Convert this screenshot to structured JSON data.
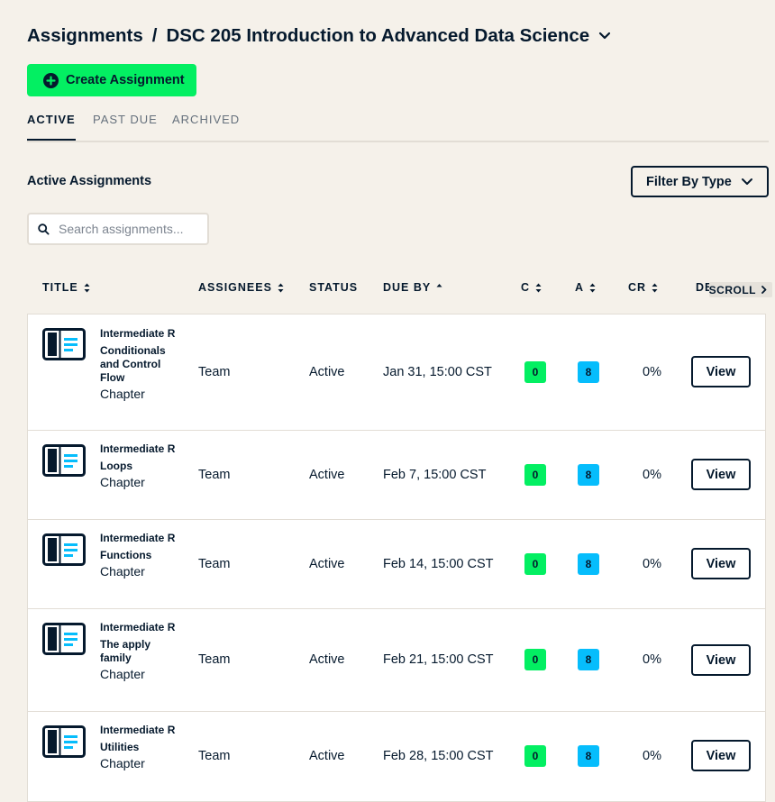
{
  "header": {
    "section": "Assignments",
    "separator": "/",
    "course": "DSC 205 Introduction to Advanced Data Science",
    "create_label": "Create Assignment"
  },
  "tabs": [
    {
      "label": "ACTIVE",
      "active": true
    },
    {
      "label": "PAST DUE",
      "active": false
    },
    {
      "label": "ARCHIVED",
      "active": false
    }
  ],
  "section": {
    "title": "Active Assignments",
    "filter_label": "Filter By Type"
  },
  "search": {
    "placeholder": "Search assignments..."
  },
  "table": {
    "columns": {
      "title": "TITLE",
      "assignees": "ASSIGNEES",
      "status": "STATUS",
      "due_by": "DUE BY",
      "c": "C",
      "a": "A",
      "cr": "CR",
      "desc": "DE"
    },
    "scroll_label": "SCROLL",
    "view_label": "View",
    "rows": [
      {
        "course": "Intermediate R",
        "chapter": "Conditionals and Control Flow",
        "type": "Chapter",
        "assignees": "Team",
        "status": "Active",
        "due": "Jan 31, 15:00 CST",
        "c": "0",
        "a": "8",
        "cr": "0%"
      },
      {
        "course": "Intermediate R",
        "chapter": "Loops",
        "type": "Chapter",
        "assignees": "Team",
        "status": "Active",
        "due": "Feb 7, 15:00 CST",
        "c": "0",
        "a": "8",
        "cr": "0%"
      },
      {
        "course": "Intermediate R",
        "chapter": "Functions",
        "type": "Chapter",
        "assignees": "Team",
        "status": "Active",
        "due": "Feb 14, 15:00 CST",
        "c": "0",
        "a": "8",
        "cr": "0%"
      },
      {
        "course": "Intermediate R",
        "chapter": "The apply family",
        "type": "Chapter",
        "assignees": "Team",
        "status": "Active",
        "due": "Feb 21, 15:00 CST",
        "c": "0",
        "a": "8",
        "cr": "0%"
      },
      {
        "course": "Intermediate R",
        "chapter": "Utilities",
        "type": "Chapter",
        "assignees": "Team",
        "status": "Active",
        "due": "Feb 28, 15:00 CST",
        "c": "0",
        "a": "8",
        "cr": "0%"
      }
    ]
  },
  "colors": {
    "background": "#f5f1ea",
    "brand_green": "#03ef62",
    "badge_blue": "#06bdfc",
    "text_navy": "#05192d"
  },
  "icons": {
    "course_dropdown": "chevron-down-icon",
    "create": "plus-circle-icon",
    "filter": "chevron-down-icon",
    "search": "search-icon",
    "sort": "sort-icon",
    "sort_asc": "sort-ascending-icon",
    "scroll": "chevron-right-icon",
    "row": "book-icon"
  }
}
